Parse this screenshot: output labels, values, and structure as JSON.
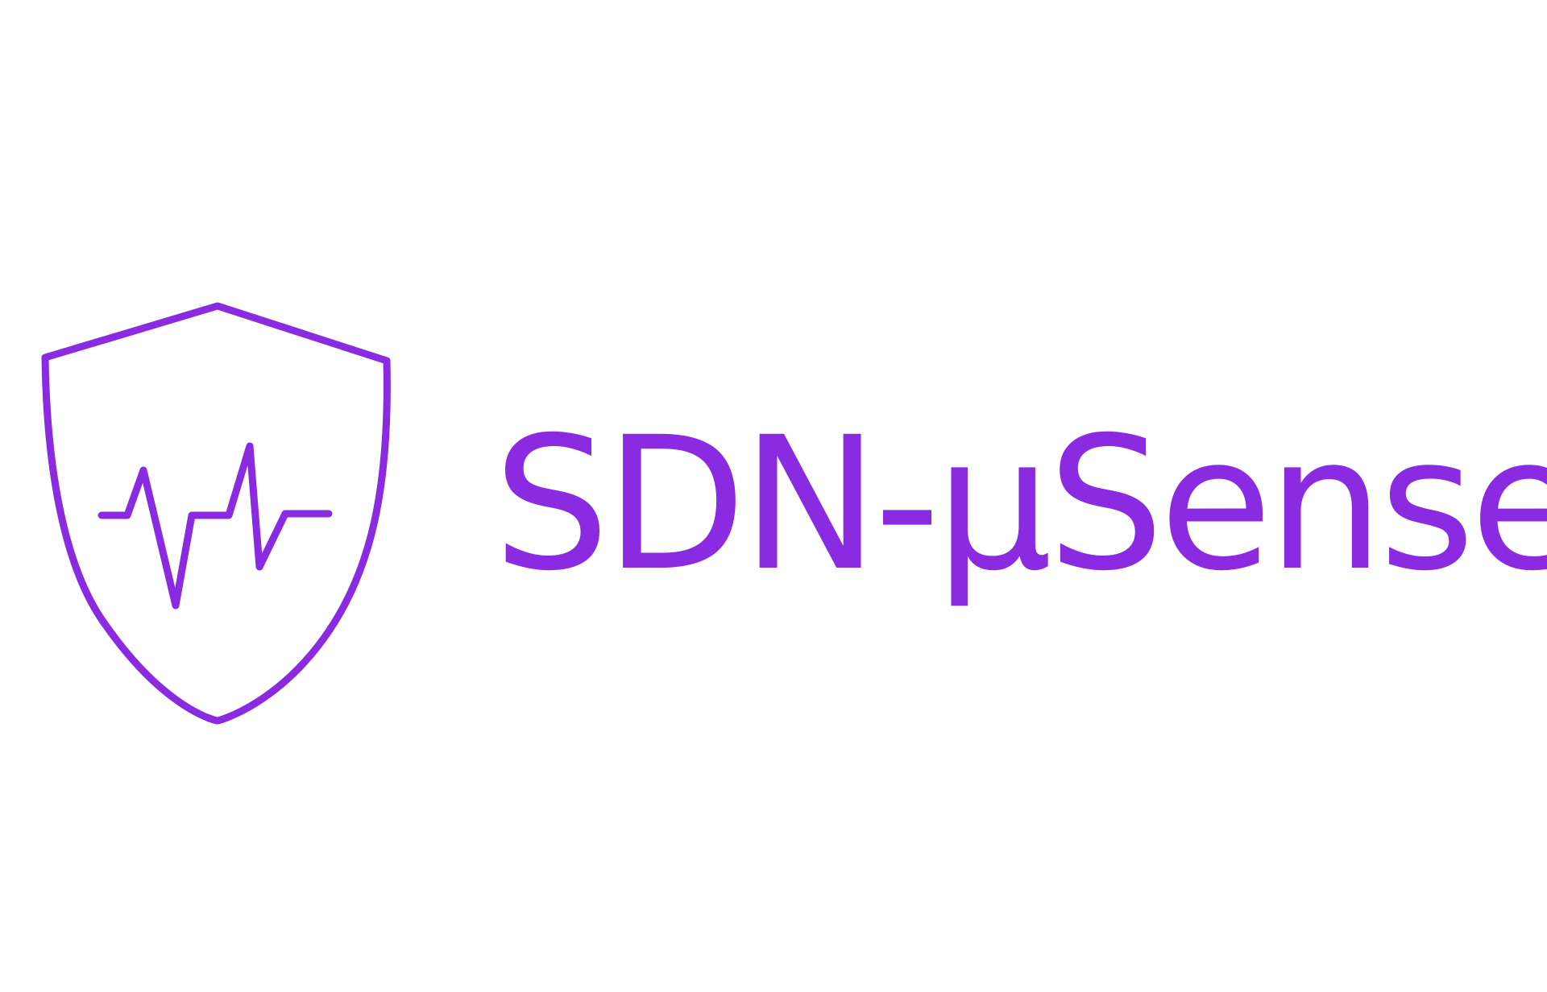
{
  "logo": {
    "wordmark": "SDN-μSense",
    "icon": "shield-heartbeat-icon",
    "color": "#8A2BE2"
  }
}
